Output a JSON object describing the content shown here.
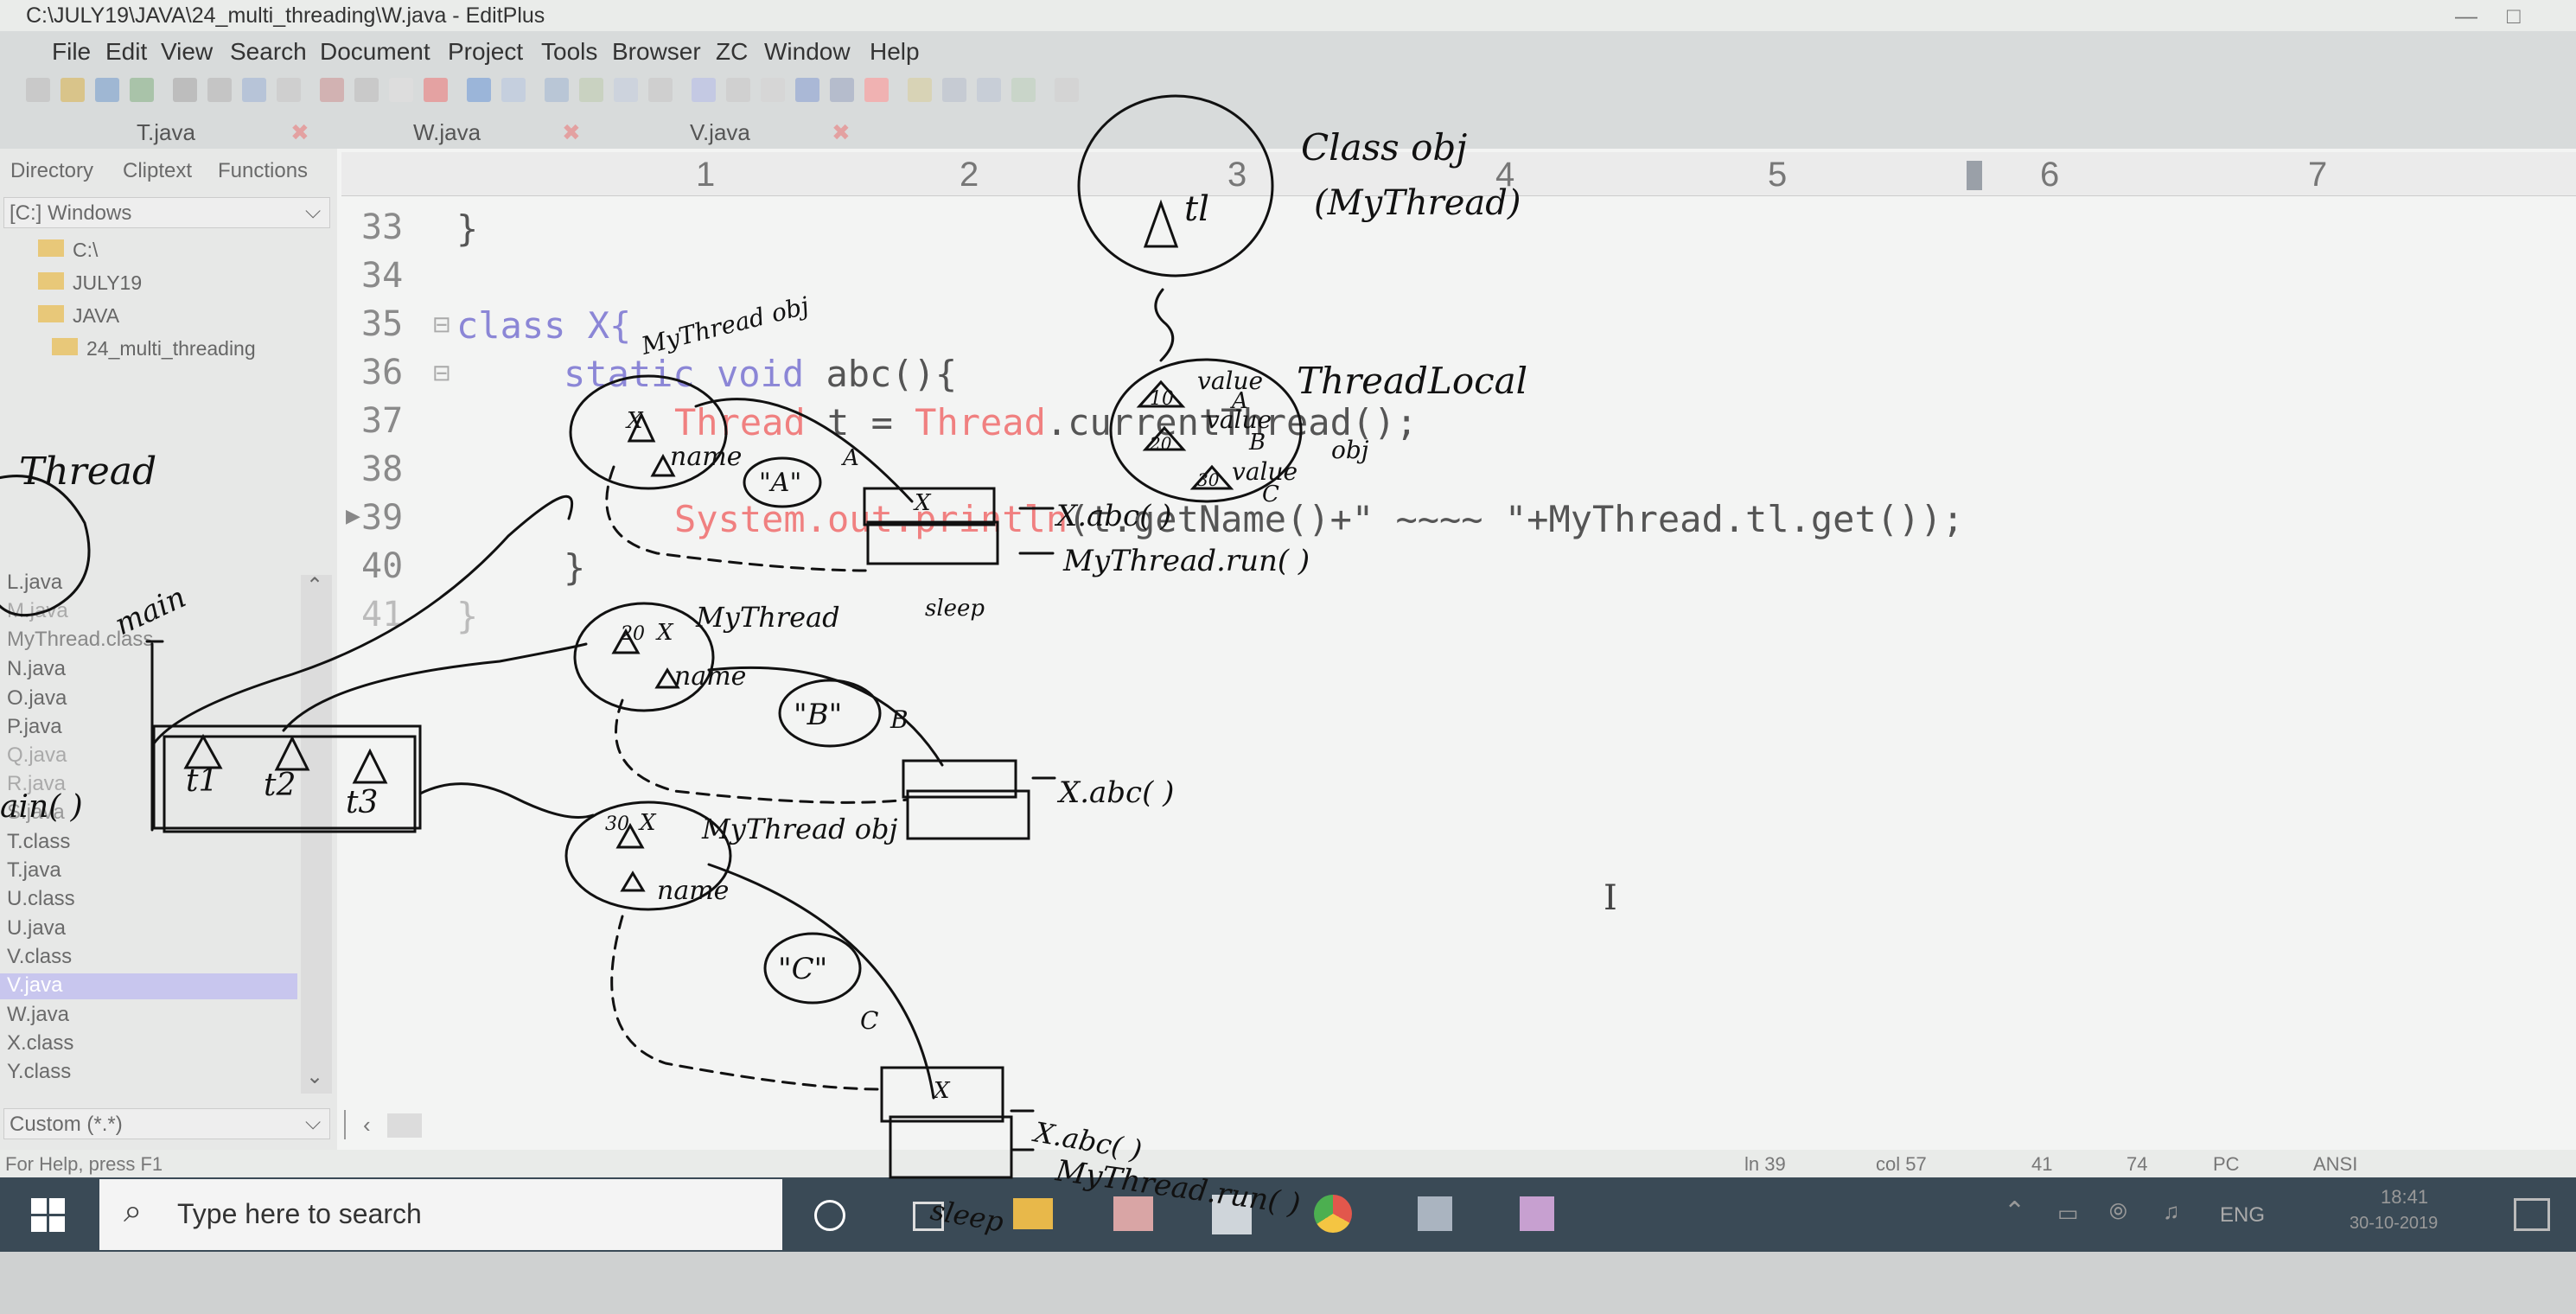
{
  "window": {
    "title": "C:\\JULY19\\JAVA\\24_multi_threading\\W.java - EditPlus"
  },
  "menu": [
    "File",
    "Edit",
    "View",
    "Search",
    "Document",
    "Project",
    "Tools",
    "Browser",
    "ZC",
    "Window",
    "Help"
  ],
  "tabs": [
    "T.java",
    "W.java",
    "V.java"
  ],
  "sidebar": {
    "tabs": [
      "Directory",
      "Cliptext",
      "Functions"
    ],
    "drive": "[C:] Windows",
    "folders": [
      "C:\\",
      "JULY19",
      "JAVA",
      "24_multi_threading"
    ],
    "files": [
      "L.java",
      "M.java",
      "MyThread.class",
      "N.java",
      "O.java",
      "P.java",
      "Q.java",
      "R.java",
      "S.java",
      "T.class",
      "T.java",
      "U.class",
      "U.java",
      "V.class",
      "V.java",
      "W.java",
      "X.class",
      "Y.class"
    ],
    "selected_file": "V.java",
    "filter": "Custom (*.*)"
  },
  "ruler": [
    "1",
    "2",
    "3",
    "4",
    "5",
    "6",
    "7"
  ],
  "code": {
    "lines": [
      "33",
      "34",
      "35",
      "36",
      "37",
      "38",
      "39",
      "40",
      "41"
    ],
    "l33": "}",
    "l35_kw": "class",
    "l35_rest": " X{",
    "l36_kw": "static void",
    "l36_rest": " abc(){",
    "l37_a": "Thread",
    "l37_b": " t = ",
    "l37_c": "Thread",
    "l37_d": ".currentThread();",
    "l39_a": "System.out.println",
    "l39_b": "(t.getName()+\" ~~~~ \"+MyThread.tl.get());",
    "l40": "}",
    "l41": "}"
  },
  "status": {
    "help": "For Help, press F1",
    "ln": "ln 39",
    "col": "col 57",
    "n1": "41",
    "n2": "74",
    "pc": "PC",
    "ansi": "ANSI"
  },
  "taskbar": {
    "search_placeholder": "Type here to search",
    "lang": "ENG",
    "time": "18:41",
    "date": "30-10-2019"
  },
  "annotations": {
    "class_obj": "Class obj",
    "mythread_paren": "(MyThread)",
    "tl": "tl",
    "threadlocal": "ThreadLocal",
    "obj": "obj",
    "value": "value",
    "thread": "Thread",
    "main": "main",
    "t1": "t1",
    "t2": "t2",
    "t3": "t3",
    "main_paren": "ain( )",
    "mythread_obj": "MyThread obj",
    "mythread": "MyThread",
    "name": "name",
    "A": "\"A\"",
    "B": "\"B\"",
    "C": "\"C\"",
    "a": "A",
    "b": "B",
    "c": "C",
    "x": "X",
    "xabc": "X.abc( )",
    "mythreadrun": "MyThread.run( )",
    "sleep": "sleep",
    "n10": "10",
    "n20": "20",
    "n30": "30"
  },
  "colors": {
    "taskbar": "#3a4a56",
    "selection": "#c8c6ee",
    "keyword": "#8b86d6",
    "red_text": "#f08080"
  }
}
